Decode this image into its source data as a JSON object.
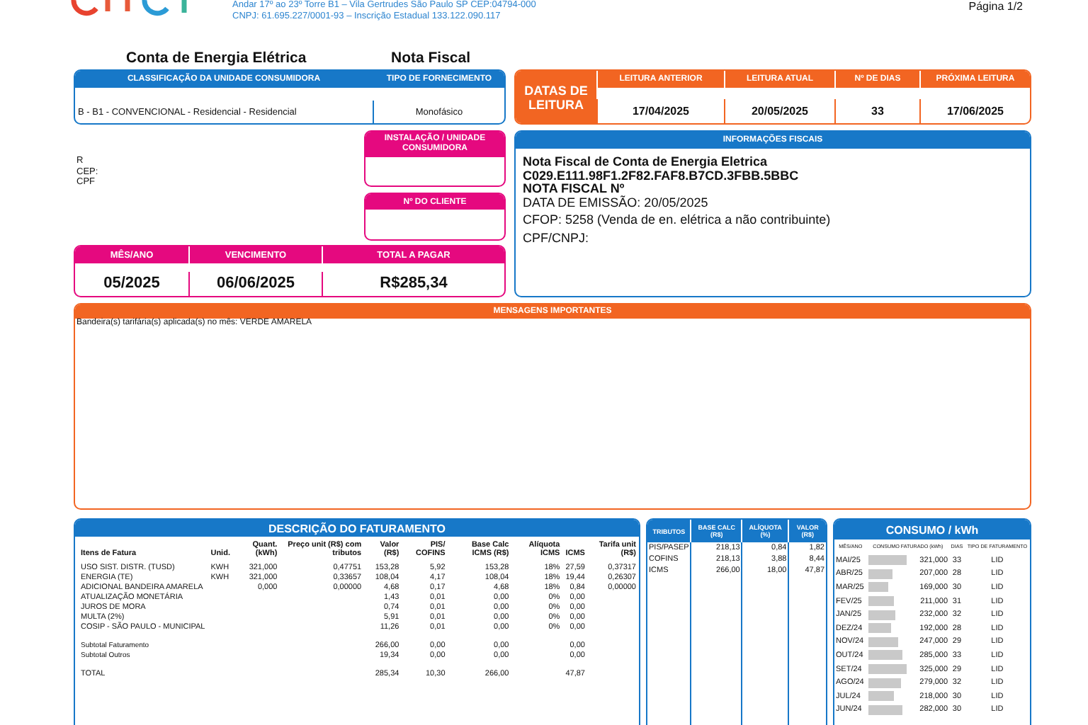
{
  "header": {
    "address": "Andar 17º ao 23º Torre B1 – Vila Gertrudes São Paulo SP CEP:04794-000",
    "company_ids": "CNPJ: 61.695.227/0001-93 – Inscrição Estadual 133.122.090.117",
    "page": "Página 1/2"
  },
  "titles": [
    "Conta de Energia Elétrica",
    "Nota Fiscal"
  ],
  "classification": {
    "columns": [
      "CLASSIFICAÇÃO DA UNIDADE CONSUMIDORA",
      "TIPO DE FORNECIMENTO"
    ],
    "values": [
      "B - B1 - CONVENCIONAL - Residencial - Residencial",
      "Monofásico"
    ]
  },
  "reading_dates": {
    "label": "DATAS DE LEITURA",
    "columns": [
      "LEITURA ANTERIOR",
      "LEITURA ATUAL",
      "Nº DE DIAS",
      "PRÓXIMA LEITURA"
    ],
    "values": [
      "17/04/2025",
      "20/05/2025",
      "33",
      "17/06/2025"
    ]
  },
  "customer": {
    "lines": [
      "R",
      "CEP:",
      "CPF"
    ]
  },
  "installation": {
    "label": "INSTALAÇÃO / UNIDADE CONSUMIDORA"
  },
  "client_number": {
    "label": "Nº DO CLIENTE"
  },
  "payment": {
    "columns": [
      "MÊS/ANO",
      "VENCIMENTO",
      "TOTAL A PAGAR"
    ],
    "values": [
      "05/2025",
      "06/06/2025",
      "R$285,34"
    ]
  },
  "fiscal_info": {
    "title": "INFORMAÇÕES FISCAIS",
    "lines": [
      {
        "text": "Nota Fiscal de Conta de Energia Eletrica",
        "bold": true
      },
      {
        "text": "C029.E111.98F1.2F82.FAF8.B7CD.3FBB.5BBC",
        "bold": true
      },
      {
        "text": "NOTA FISCAL Nº",
        "bold": true
      },
      {
        "text": "DATA DE EMISSÃO: 20/05/2025",
        "bold": false
      },
      {
        "text": "CFOP: 5258 (Venda de en. elétrica a não contribuinte)",
        "bold": false
      },
      {
        "text": "CPF/CNPJ:",
        "bold": false
      }
    ]
  },
  "messages": {
    "title": "MENSAGENS IMPORTANTES",
    "text": "Bandeira(s) tarifária(s) aplicada(s) no mês: VERDE AMARELA"
  },
  "billing": {
    "title": "DESCRIÇÃO DO FATURAMENTO",
    "columns": [
      "Itens de Fatura",
      "Unid.",
      "Quant. (kWh)",
      "Preço unit (R$) com tributos",
      "Valor (R$)",
      "PIS/ COFINS",
      "Base Calc ICMS (R$)",
      "Alíquota ICMS",
      "ICMS",
      "Tarifa unit (R$)"
    ],
    "rows": [
      {
        "kind": "item",
        "cells": [
          "USO SIST. DISTR. (TUSD)",
          "KWH",
          "321,000",
          "0,47751",
          "153,28",
          "5,92",
          "153,28",
          "18%",
          "27,59",
          "0,37317"
        ]
      },
      {
        "kind": "item",
        "cells": [
          "ENERGIA (TE)",
          "KWH",
          "321,000",
          "0,33657",
          "108,04",
          "4,17",
          "108,04",
          "18%",
          "19,44",
          "0,26307"
        ]
      },
      {
        "kind": "item",
        "cells": [
          "ADICIONAL BANDEIRA AMARELA",
          null,
          "0,000",
          "0,00000",
          "4,68",
          "0,17",
          "4,68",
          "18%",
          "0,84",
          "0,00000"
        ]
      },
      {
        "kind": "item",
        "cells": [
          "ATUALIZAÇÃO MONETÁRIA",
          null,
          null,
          null,
          "1,43",
          "0,01",
          "0,00",
          "0%",
          "0,00",
          null
        ]
      },
      {
        "kind": "item",
        "cells": [
          "JUROS DE MORA",
          null,
          null,
          null,
          "0,74",
          "0,01",
          "0,00",
          "0%",
          "0,00",
          null
        ]
      },
      {
        "kind": "item",
        "cells": [
          "MULTA (2%)",
          null,
          null,
          null,
          "5,91",
          "0,01",
          "0,00",
          "0%",
          "0,00",
          null
        ]
      },
      {
        "kind": "item",
        "cells": [
          "COSIP - SÃO PAULO - MUNICIPAL",
          null,
          null,
          null,
          "11,26",
          "0,01",
          "0,00",
          "0%",
          "0,00",
          null
        ]
      },
      {
        "kind": "subtotal",
        "cells": [
          "Subtotal Faturamento",
          null,
          null,
          null,
          "266,00",
          "0,00",
          "0,00",
          null,
          "0,00",
          null
        ]
      },
      {
        "kind": "subtotal",
        "cells": [
          "Subtotal Outros",
          null,
          null,
          null,
          "19,34",
          "0,00",
          "0,00",
          null,
          "0,00",
          null
        ]
      },
      {
        "kind": "total",
        "cells": [
          "TOTAL",
          null,
          null,
          null,
          "285,34",
          "10,30",
          "266,00",
          null,
          "47,87",
          null
        ]
      }
    ]
  },
  "taxes": {
    "columns": [
      "TRIBUTOS",
      "BASE CALC (R$)",
      "ALÍQUOTA (%)",
      "VALOR (R$)"
    ],
    "rows": [
      [
        "PIS/PASEP",
        "218,13",
        "0,84",
        "1,82"
      ],
      [
        "COFINS",
        "218,13",
        "3,88",
        "8,44"
      ],
      [
        "ICMS",
        "266,00",
        "18,00",
        "47,87"
      ]
    ]
  },
  "consumption": {
    "title": "CONSUMO / kWh",
    "columns": [
      "MÊS/ANO",
      "CONSUMO FATURADO (kWh)",
      "DIAS",
      "TIPO DE FATURAMENTO"
    ],
    "rows": [
      {
        "month": "MAI/25",
        "level": 0.845,
        "kwh": "321,000",
        "days": "33",
        "type": "LID"
      },
      {
        "month": "ABR/25",
        "level": 0.545,
        "kwh": "207,000",
        "days": "28",
        "type": "LID"
      },
      {
        "month": "MAR/25",
        "level": 0.445,
        "kwh": "169,000",
        "days": "30",
        "type": "LID"
      },
      {
        "month": "FEV/25",
        "level": 0.555,
        "kwh": "211,000",
        "days": "31",
        "type": "LID"
      },
      {
        "month": "JAN/25",
        "level": 0.61,
        "kwh": "232,000",
        "days": "32",
        "type": "LID"
      },
      {
        "month": "DEZ/24",
        "level": 0.505,
        "kwh": "192,000",
        "days": "28",
        "type": "LID"
      },
      {
        "month": "NOV/24",
        "level": 0.65,
        "kwh": "247,000",
        "days": "29",
        "type": "LID"
      },
      {
        "month": "OUT/24",
        "level": 0.75,
        "kwh": "285,000",
        "days": "33",
        "type": "LID"
      },
      {
        "month": "SET/24",
        "level": 0.855,
        "kwh": "325,000",
        "days": "29",
        "type": "LID"
      },
      {
        "month": "AGO/24",
        "level": 0.734,
        "kwh": "279,000",
        "days": "32",
        "type": "LID"
      },
      {
        "month": "JUL/24",
        "level": 0.574,
        "kwh": "218,000",
        "days": "30",
        "type": "LID"
      },
      {
        "month": "JUN/24",
        "level": 0.742,
        "kwh": "282,000",
        "days": "30",
        "type": "LID"
      }
    ]
  }
}
